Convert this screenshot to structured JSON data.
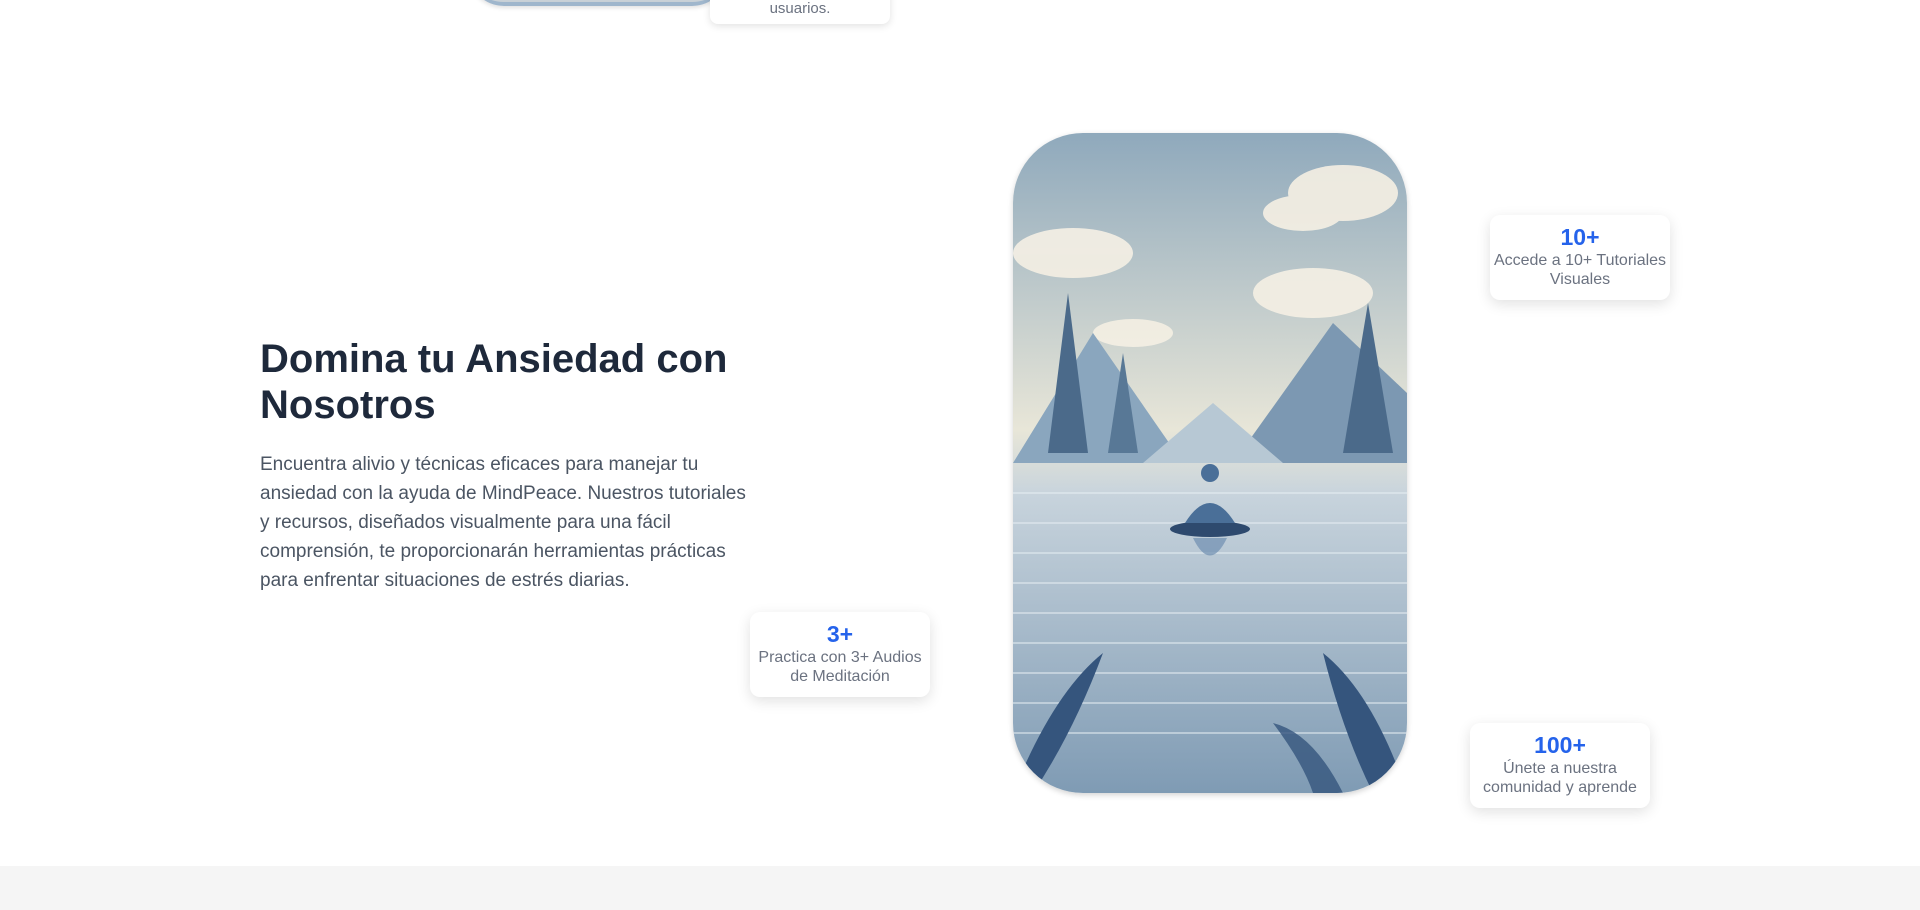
{
  "previous_section": {
    "card_text": "usuarios."
  },
  "hero": {
    "title": "Domina tu Ansiedad con Nosotros",
    "description": "Encuentra alivio y técnicas eficaces para manejar tu ansiedad con la ayuda de MindPeace. Nuestros tutoriales y recursos, diseñados visualmente para una fácil comprensión, te proporcionarán herramientas prácticas para enfrentar situaciones de estrés diarias."
  },
  "stats": [
    {
      "value": "3+",
      "label": "Practica con 3+ Audios de Meditación"
    },
    {
      "value": "10+",
      "label": "Accede a 10+ Tutoriales Visuales"
    },
    {
      "value": "100+",
      "label": "Únete a nuestra comunidad y aprende"
    }
  ],
  "colors": {
    "accent": "#2563eb",
    "heading": "#1e293b",
    "body_text": "#4b5563",
    "muted_text": "#6b7280"
  }
}
